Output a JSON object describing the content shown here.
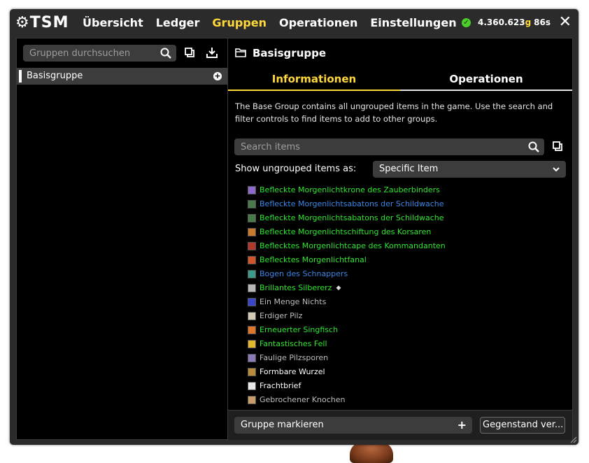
{
  "header": {
    "logo_text": "TSM",
    "nav": [
      {
        "label": "Übersicht",
        "active": false
      },
      {
        "label": "Ledger",
        "active": false
      },
      {
        "label": "Gruppen",
        "active": true
      },
      {
        "label": "Operationen",
        "active": false
      },
      {
        "label": "Einstellungen",
        "active": false
      }
    ],
    "gold_amount": "4.360.623",
    "gold_unit": "g",
    "latency": "86s",
    "close_icon": "close-icon"
  },
  "left": {
    "search_placeholder": "Gruppen durchsuchen",
    "groups": [
      {
        "label": "Basisgruppe"
      }
    ]
  },
  "right": {
    "title": "Basisgruppe",
    "tabs": {
      "info": "Informationen",
      "ops": "Operationen"
    },
    "description": "The Base Group contains all ungrouped items in the game. Use the search and filter controls to find items to add to other groups.",
    "search_placeholder": "Search items",
    "show_label": "Show ungrouped items as:",
    "select_value": "Specific Item",
    "items": [
      {
        "name": "Befleckte Morgenlichtkrone des Zauberbinders",
        "color": "#2ee62e",
        "icon_color": "#8b6acb"
      },
      {
        "name": "Befleckte Morgenlichtsabatons der Schildwache",
        "color": "#3b86e6",
        "icon_color": "#4a7a4a"
      },
      {
        "name": "Befleckte Morgenlichtsabatons der Schildwache",
        "color": "#2ee62e",
        "icon_color": "#4a7a4a"
      },
      {
        "name": "Befleckte Morgenlichtschiftung des Korsaren",
        "color": "#2ee62e",
        "icon_color": "#c9792a"
      },
      {
        "name": "Beflecktes Morgenlichtcape des Kommandanten",
        "color": "#2ee62e",
        "icon_color": "#b3372a"
      },
      {
        "name": "Beflecktes Morgenlichtfanal",
        "color": "#2ee62e",
        "icon_color": "#d4542a"
      },
      {
        "name": "Bogen des Schnappers",
        "color": "#3b86e6",
        "icon_color": "#3b9a8a"
      },
      {
        "name": "Brillantes Silbererz",
        "color": "#2ee62e",
        "icon_color": "#b7b7b7",
        "extra": "◆"
      },
      {
        "name": "Ein Menge Nichts",
        "color": "#bdbdbd",
        "icon_color": "#3848c8"
      },
      {
        "name": "Erdiger Pilz",
        "color": "#bdbdbd",
        "icon_color": "#d2c9b4"
      },
      {
        "name": "Erneuerter Singfisch",
        "color": "#2ee62e",
        "icon_color": "#e0752a"
      },
      {
        "name": "Fantastisches Fell",
        "color": "#2ee62e",
        "icon_color": "#e2b82a"
      },
      {
        "name": "Faulige Pilzsporen",
        "color": "#bdbdbd",
        "icon_color": "#8a7ab8"
      },
      {
        "name": "Formbare Wurzel",
        "color": "#ffffff",
        "icon_color": "#b88a3a"
      },
      {
        "name": "Frachtbrief",
        "color": "#ffffff",
        "icon_color": "#e8e8e8"
      },
      {
        "name": "Gebrochener Knochen",
        "color": "#bdbdbd",
        "icon_color": "#c99a6a"
      }
    ],
    "footer": {
      "mark_label": "Gruppe markieren",
      "item_button": "Gegenstand ver..."
    }
  },
  "colors": {
    "accent": "#ffd839",
    "frame": "#2b2b2b",
    "panel": "#000000",
    "input": "#3c3c3c",
    "online": "#4ccf2a"
  }
}
